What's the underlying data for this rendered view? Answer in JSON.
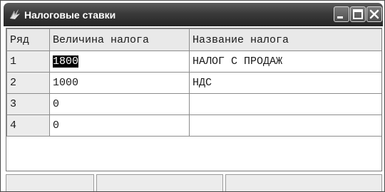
{
  "window": {
    "title": "Налоговые ставки",
    "icon": "app-icon"
  },
  "controls": {
    "minimize_icon": "minimize-icon",
    "maximize_icon": "maximize-icon",
    "close_icon": "close-icon"
  },
  "grid": {
    "columns": [
      "Ряд",
      "Величина налога",
      "Название налога"
    ],
    "rows": [
      {
        "num": "1",
        "value": "1800",
        "name": "НАЛОГ С ПРОДАЖ"
      },
      {
        "num": "2",
        "value": "1000",
        "name": "НДС"
      },
      {
        "num": "3",
        "value": "0",
        "name": ""
      },
      {
        "num": "4",
        "value": "0",
        "name": ""
      }
    ]
  }
}
